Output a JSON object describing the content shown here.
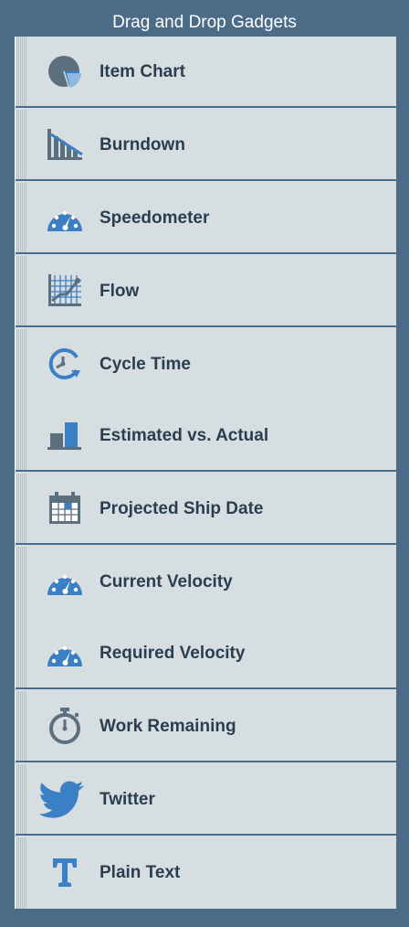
{
  "panel": {
    "title": "Drag and Drop Gadgets"
  },
  "colors": {
    "background": "#4b6b87",
    "item_background": "#d6dee2",
    "label_text": "#2b3e50",
    "icon_blue": "#3b7fc4",
    "icon_gray": "#5c6f7e"
  },
  "gadgets": [
    {
      "label": "Item Chart",
      "icon": "pie-chart-icon"
    },
    {
      "label": "Burndown",
      "icon": "burndown-chart-icon"
    },
    {
      "label": "Speedometer",
      "icon": "speedometer-icon"
    },
    {
      "label": "Flow",
      "icon": "flow-chart-icon"
    },
    {
      "label": "Cycle Time",
      "icon": "cycle-time-icon"
    },
    {
      "label": "Estimated vs. Actual",
      "icon": "bar-chart-icon"
    },
    {
      "label": "Projected Ship Date",
      "icon": "calendar-icon"
    },
    {
      "label": "Current Velocity",
      "icon": "speedometer-icon"
    },
    {
      "label": "Required Velocity",
      "icon": "speedometer-icon"
    },
    {
      "label": "Work Remaining",
      "icon": "stopwatch-icon"
    },
    {
      "label": "Twitter",
      "icon": "twitter-bird-icon"
    },
    {
      "label": "Plain Text",
      "icon": "text-t-icon"
    }
  ]
}
